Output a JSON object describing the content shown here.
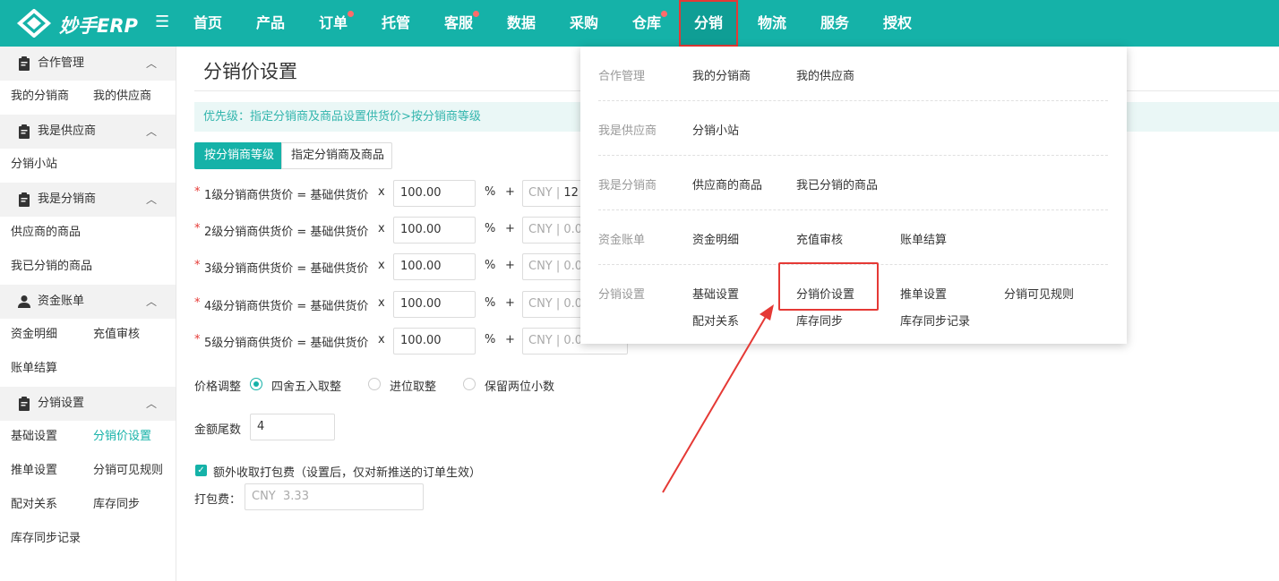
{
  "brand": {
    "name": "妙手ERP"
  },
  "colors": {
    "primary": "#15b2a8",
    "alert": "#e53935",
    "badge": "#ff6b6b"
  },
  "nav": {
    "items": [
      {
        "label": "首页"
      },
      {
        "label": "产品"
      },
      {
        "label": "订单",
        "badge": true
      },
      {
        "label": "托管"
      },
      {
        "label": "客服",
        "badge": true
      },
      {
        "label": "数据"
      },
      {
        "label": "采购"
      },
      {
        "label": "仓库",
        "badge": true
      },
      {
        "label": "分销",
        "active": true
      },
      {
        "label": "物流"
      },
      {
        "label": "服务"
      },
      {
        "label": "授权"
      }
    ]
  },
  "sidebar": {
    "groups": [
      {
        "label": "合作管理",
        "icon": "clipboard-icon",
        "links": [
          "我的分销商",
          "我的供应商"
        ]
      },
      {
        "label": "我是供应商",
        "icon": "clipboard-icon",
        "links": [
          "分销小站"
        ]
      },
      {
        "label": "我是分销商",
        "icon": "clipboard-icon",
        "links": [
          "供应商的商品",
          "我已分销的商品"
        ]
      },
      {
        "label": "资金账单",
        "icon": "user-icon",
        "links": [
          "资金明细",
          "充值审核",
          "账单结算"
        ]
      },
      {
        "label": "分销设置",
        "icon": "clipboard-icon",
        "links": [
          "基础设置",
          "分销价设置",
          "推单设置",
          "分销可见规则",
          "配对关系",
          "库存同步",
          "库存同步记录"
        ],
        "active_link": "分销价设置"
      }
    ]
  },
  "main": {
    "title": "分销价设置",
    "notice": "优先级：指定分销商及商品设置供货价>按分销商等级",
    "tabs": [
      {
        "label": "按分销商等级",
        "active": true
      },
      {
        "label": "指定分销商及商品"
      }
    ],
    "tiers": [
      {
        "label": "1级分销商供货价 = 基础供货价",
        "percent": "100.00",
        "currency": "CNY",
        "amount": "12"
      },
      {
        "label": "2级分销商供货价 = 基础供货价",
        "percent": "100.00",
        "currency": "CNY",
        "amount": "0.0"
      },
      {
        "label": "3级分销商供货价 = 基础供货价",
        "percent": "100.00",
        "currency": "CNY",
        "amount": "0.0"
      },
      {
        "label": "4级分销商供货价 = 基础供货价",
        "percent": "100.00",
        "currency": "CNY",
        "amount": "0.0"
      },
      {
        "label": "5级分销商供货价 = 基础供货价",
        "percent": "100.00",
        "currency": "CNY",
        "amount": "0.0"
      }
    ],
    "times_symbol": "x",
    "percent_symbol": "%",
    "plus_symbol": "+",
    "rounding": {
      "label": "价格调整",
      "options": [
        "四舍五入取整",
        "进位取整",
        "保留两位小数"
      ],
      "selected": "四舍五入取整"
    },
    "amount_tail": {
      "label": "金额尾数",
      "value": "4"
    },
    "packing": {
      "checkbox_label": "额外收取打包费（设置后，仅对新推送的订单生效）",
      "checked": true,
      "fee_label": "打包费：",
      "currency": "CNY",
      "fee_value": "3.33"
    }
  },
  "dropdown": {
    "rows": [
      {
        "label": "合作管理",
        "links": [
          "我的分销商",
          "我的供应商"
        ]
      },
      {
        "label": "我是供应商",
        "links": [
          "分销小站"
        ]
      },
      {
        "label": "我是分销商",
        "links": [
          "供应商的商品",
          "我已分销的商品"
        ]
      },
      {
        "label": "资金账单",
        "links": [
          "资金明细",
          "充值审核",
          "账单结算"
        ]
      },
      {
        "label": "分销设置",
        "links": [
          "基础设置",
          "分销价设置",
          "推单设置",
          "分销可见规则",
          "配对关系",
          "库存同步",
          "库存同步记录"
        ],
        "highlighted": "分销价设置"
      }
    ]
  }
}
